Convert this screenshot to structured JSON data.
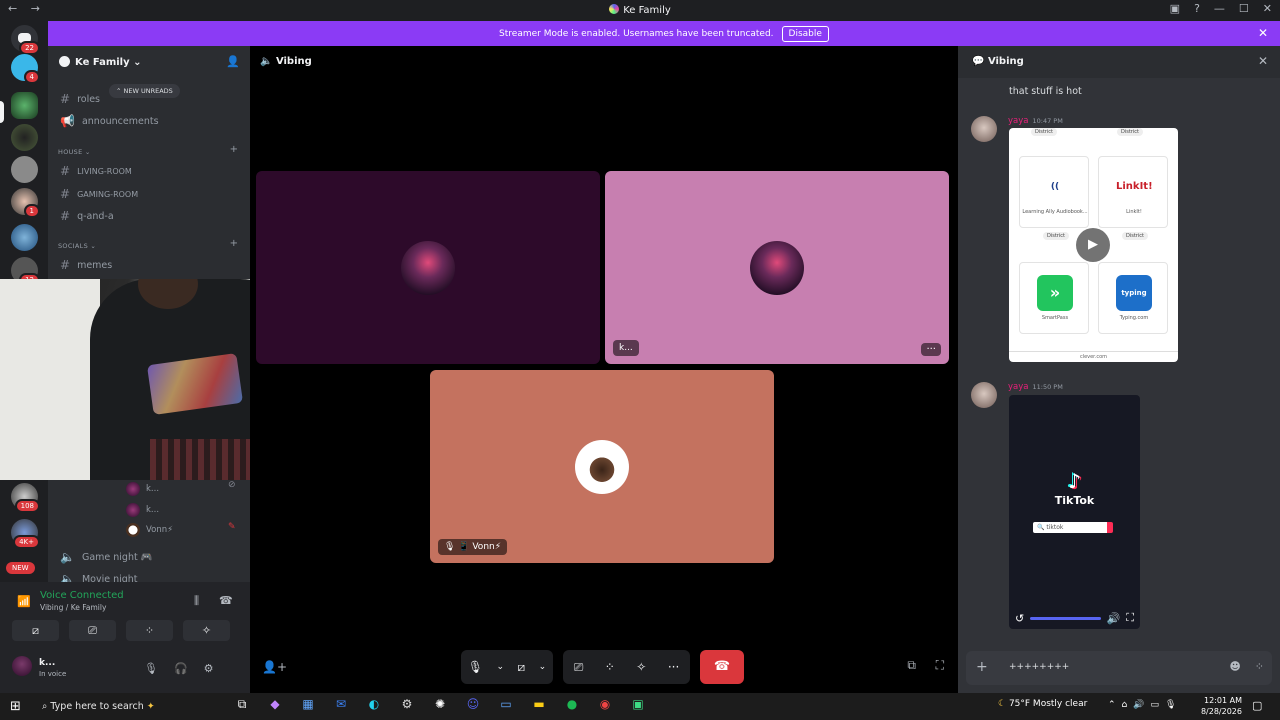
{
  "window": {
    "title": "Ke Family",
    "back": "←",
    "forward": "→",
    "controls": [
      "▣",
      "?",
      "—",
      "☐",
      "✕"
    ]
  },
  "banner": {
    "text": "Streamer Mode is enabled. Usernames have been truncated.",
    "button": "Disable",
    "close": "✕"
  },
  "servers": {
    "home_badge": "22",
    "badges": [
      "4",
      "1",
      "12",
      "108",
      "4K+"
    ],
    "new_label": "NEW"
  },
  "sidebar": {
    "server_name": "Ke Family",
    "chevron": "⌄",
    "new_unreads": "⌃ NEW UNREADS",
    "channels_top": [
      {
        "name": "roles",
        "icon": "#"
      },
      {
        "name": "announcements",
        "icon": "📢"
      }
    ],
    "categories": [
      {
        "name": "HOUSE ⌄",
        "channels": [
          "LIVING-ROOM",
          "GAMING-ROOM",
          "q-and-a"
        ]
      },
      {
        "name": "SOCIALS ⌄",
        "channels": [
          "memes"
        ]
      }
    ],
    "voice_members": [
      {
        "name": "k..."
      },
      {
        "name": "k..."
      },
      {
        "name": "Vonn⚡"
      }
    ],
    "voice_channels": [
      {
        "name": "Game night 🎮"
      },
      {
        "name": "Movie night"
      }
    ]
  },
  "voice_panel": {
    "status": "Voice Connected",
    "location": "Vibing / Ke Family",
    "user": "k...",
    "user_status": "In voice"
  },
  "stage": {
    "title": "Vibing",
    "tiles": [
      {
        "label": "",
        "color": "#2d0a2a"
      },
      {
        "label": "k...",
        "color": "#c77fb0"
      },
      {
        "label": "🎙 📱 Vonn⚡",
        "color": "#c4725f"
      }
    ],
    "more_label": "···"
  },
  "chat": {
    "title": "Vibing",
    "first_message": "that stuff is hot",
    "messages": [
      {
        "author": "yaya",
        "time": "10:47 PM"
      },
      {
        "author": "yaya",
        "time": "11:50 PM"
      }
    ],
    "image_apps": [
      {
        "name": "Learning Ally Audiobook...",
        "icon": "((",
        "tag": "District"
      },
      {
        "name": "LinkIt!",
        "icon": "LinkIt!",
        "tag": "District"
      },
      {
        "name": "SmartPass",
        "icon": "»",
        "tag": "District"
      },
      {
        "name": "Typing.com",
        "icon": "typing",
        "tag": "District"
      }
    ],
    "image_tags": [
      "District",
      "District"
    ],
    "image_footer": "clever.com",
    "video": {
      "brand": "TikTok",
      "search_text": "🔍 tiktok"
    },
    "input_text": "++++++++"
  },
  "taskbar": {
    "search_placeholder": "Type here to search",
    "weather": "75°F  Mostly clear",
    "time": "12:01 AM",
    "date": "8/28/2026"
  }
}
